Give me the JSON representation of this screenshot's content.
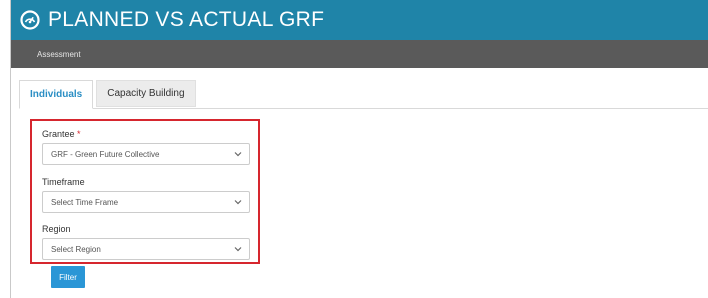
{
  "header": {
    "title": "PLANNED VS ACTUAL GRF",
    "logo_icon": "dashboard-gauge-icon",
    "background": "#1f84a8"
  },
  "subnav": {
    "items": [
      "Assessment"
    ]
  },
  "tabs": [
    {
      "label": "Individuals",
      "active": true
    },
    {
      "label": "Capacity Building",
      "active": false
    }
  ],
  "filters": {
    "grantee": {
      "label": "Grantee",
      "required_mark": "*",
      "value": "GRF - Green Future Collective"
    },
    "timeframe": {
      "label": "Timeframe",
      "value": "Select Time Frame"
    },
    "region": {
      "label": "Region",
      "value": "Select Region"
    },
    "highlight_color": "#d6262e"
  },
  "actions": {
    "filter_label": "Filter"
  }
}
